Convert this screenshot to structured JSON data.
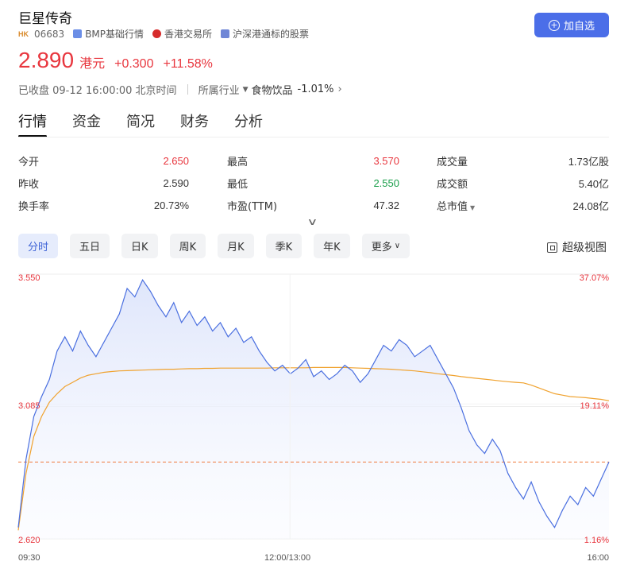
{
  "header": {
    "name": "巨星传奇",
    "market_badge": "HK",
    "code": "06683",
    "tags": [
      {
        "icon": "bmp-icon",
        "label": "BMP基础行情"
      },
      {
        "icon": "hkex-icon",
        "label": "香港交易所"
      },
      {
        "icon": "connect-icon",
        "label": "沪深港通标的股票"
      }
    ],
    "add_button_label": "加自选"
  },
  "quote": {
    "price": "2.890",
    "currency": "港元",
    "change": "+0.300",
    "change_pct": "+11.58%"
  },
  "status": {
    "closed_text": "已收盘 09-12 16:00:00 北京时间",
    "industry_label": "所属行业",
    "industry_name": "食物饮品",
    "industry_change": "-1.01%"
  },
  "tabs": [
    {
      "label": "行情",
      "active": true
    },
    {
      "label": "资金",
      "active": false
    },
    {
      "label": "简况",
      "active": false
    },
    {
      "label": "财务",
      "active": false
    },
    {
      "label": "分析",
      "active": false
    }
  ],
  "stats": [
    [
      {
        "label": "今开",
        "value": "2.650",
        "tone": "up"
      },
      {
        "label": "最高",
        "value": "3.570",
        "tone": "up"
      },
      {
        "label": "成交量",
        "value": "1.73亿股",
        "tone": "neutral"
      }
    ],
    [
      {
        "label": "昨收",
        "value": "2.590",
        "tone": "neutral"
      },
      {
        "label": "最低",
        "value": "2.550",
        "tone": "down"
      },
      {
        "label": "成交额",
        "value": "5.40亿",
        "tone": "neutral"
      }
    ],
    [
      {
        "label": "换手率",
        "value": "20.73%",
        "tone": "neutral"
      },
      {
        "label": "市盈(TTM)",
        "value": "47.32",
        "tone": "neutral"
      },
      {
        "label": "总市值",
        "value": "24.08亿",
        "tone": "neutral"
      }
    ]
  ],
  "periods": [
    {
      "label": "分时",
      "active": true
    },
    {
      "label": "五日",
      "active": false
    },
    {
      "label": "日K",
      "active": false
    },
    {
      "label": "周K",
      "active": false
    },
    {
      "label": "月K",
      "active": false
    },
    {
      "label": "季K",
      "active": false
    },
    {
      "label": "年K",
      "active": false
    },
    {
      "label": "更多",
      "active": false
    }
  ],
  "super_view_label": "超级视图",
  "colors": {
    "up": "#e8363e",
    "down": "#1a9e4a",
    "accent": "#4b6ee8",
    "price_line": "#4a6fe0",
    "avg_line": "#f0a22e",
    "prev_close_line": "#f07a3c"
  },
  "chart_data": {
    "type": "line",
    "left_axis": {
      "max": "3.550",
      "mid": "3.085",
      "min": "2.620"
    },
    "right_axis": {
      "max": "37.07%",
      "mid": "19.11%",
      "min": "1.16%"
    },
    "x_ticks": [
      "09:30",
      "12:00/13:00",
      "16:00"
    ],
    "ylim": [
      2.62,
      3.55
    ],
    "prev_close": 2.59,
    "prev_close_line_value": 2.89,
    "series": [
      {
        "role": "price",
        "values": [
          2.66,
          2.9,
          3.05,
          3.12,
          3.18,
          3.28,
          3.33,
          3.28,
          3.35,
          3.3,
          3.26,
          3.31,
          3.36,
          3.41,
          3.5,
          3.47,
          3.53,
          3.49,
          3.44,
          3.4,
          3.45,
          3.38,
          3.42,
          3.37,
          3.4,
          3.35,
          3.38,
          3.33,
          3.36,
          3.31,
          3.33,
          3.28,
          3.24,
          3.21,
          3.23,
          3.2,
          3.22,
          3.25,
          3.19,
          3.21,
          3.18,
          3.2,
          3.23,
          3.21,
          3.17,
          3.2,
          3.25,
          3.3,
          3.28,
          3.32,
          3.3,
          3.26,
          3.28,
          3.3,
          3.25,
          3.2,
          3.15,
          3.08,
          3.0,
          2.95,
          2.92,
          2.97,
          2.93,
          2.85,
          2.8,
          2.76,
          2.82,
          2.75,
          2.7,
          2.66,
          2.72,
          2.77,
          2.74,
          2.8,
          2.77,
          2.83,
          2.89
        ]
      },
      {
        "role": "average",
        "values": [
          2.65,
          2.85,
          2.98,
          3.05,
          3.1,
          3.13,
          3.155,
          3.17,
          3.185,
          3.195,
          3.2,
          3.205,
          3.208,
          3.21,
          3.211,
          3.212,
          3.213,
          3.214,
          3.215,
          3.216,
          3.216,
          3.217,
          3.218,
          3.218,
          3.219,
          3.219,
          3.22,
          3.22,
          3.22,
          3.22,
          3.22,
          3.22,
          3.22,
          3.221,
          3.221,
          3.221,
          3.221,
          3.221,
          3.222,
          3.222,
          3.222,
          3.222,
          3.222,
          3.221,
          3.22,
          3.219,
          3.218,
          3.217,
          3.216,
          3.214,
          3.212,
          3.21,
          3.207,
          3.204,
          3.2,
          3.197,
          3.194,
          3.19,
          3.187,
          3.184,
          3.181,
          3.178,
          3.175,
          3.172,
          3.17,
          3.168,
          3.16,
          3.15,
          3.14,
          3.13,
          3.125,
          3.12,
          3.118,
          3.116,
          3.113,
          3.11,
          3.105
        ]
      }
    ]
  }
}
